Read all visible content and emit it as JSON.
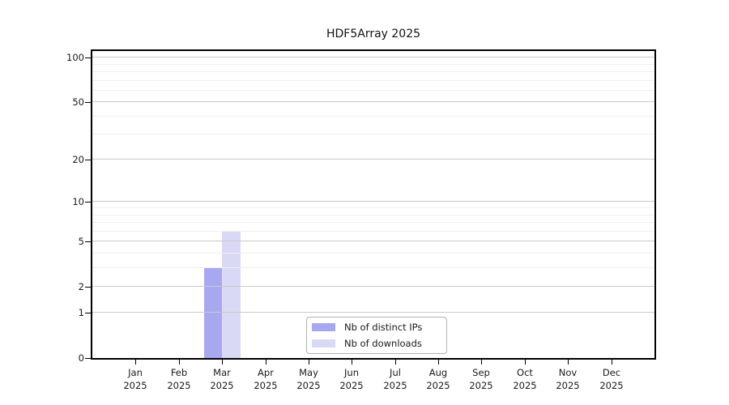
{
  "title": "HDF5Array 2025",
  "legend": {
    "items": [
      {
        "label": "Nb of distinct IPs",
        "color": "#a8a8f0"
      },
      {
        "label": "Nb of downloads",
        "color": "#d9d9f6"
      }
    ]
  },
  "chart_data": {
    "type": "bar",
    "title": "HDF5Array 2025",
    "categories": [
      "Jan",
      "Feb",
      "Mar",
      "Apr",
      "May",
      "Jun",
      "Jul",
      "Aug",
      "Sep",
      "Oct",
      "Nov",
      "Dec"
    ],
    "x_sub_label": "2025",
    "series": [
      {
        "name": "Nb of distinct IPs",
        "color": "#a8a8f0",
        "values": [
          0,
          0,
          3,
          0,
          0,
          0,
          0,
          0,
          0,
          0,
          0,
          0
        ]
      },
      {
        "name": "Nb of downloads",
        "color": "#d9d9f6",
        "values": [
          0,
          0,
          6,
          0,
          0,
          0,
          0,
          0,
          0,
          0,
          0,
          0
        ]
      }
    ],
    "y_axis": {
      "scale": "log1p",
      "ticks": [
        0,
        1,
        2,
        5,
        10,
        20,
        50,
        100
      ],
      "major_gridlines": [
        1,
        2,
        5,
        10,
        20,
        50,
        100
      ],
      "minor_gridlines": [
        3,
        4,
        6,
        7,
        8,
        9,
        30,
        40,
        60,
        70,
        80,
        90
      ],
      "ylim": [
        0,
        111
      ]
    },
    "grid": true,
    "legend_position": "bottom-center",
    "colors": {
      "major_grid": "#c9c9c9",
      "minor_grid": "#efefef",
      "axis": "#000000"
    }
  }
}
